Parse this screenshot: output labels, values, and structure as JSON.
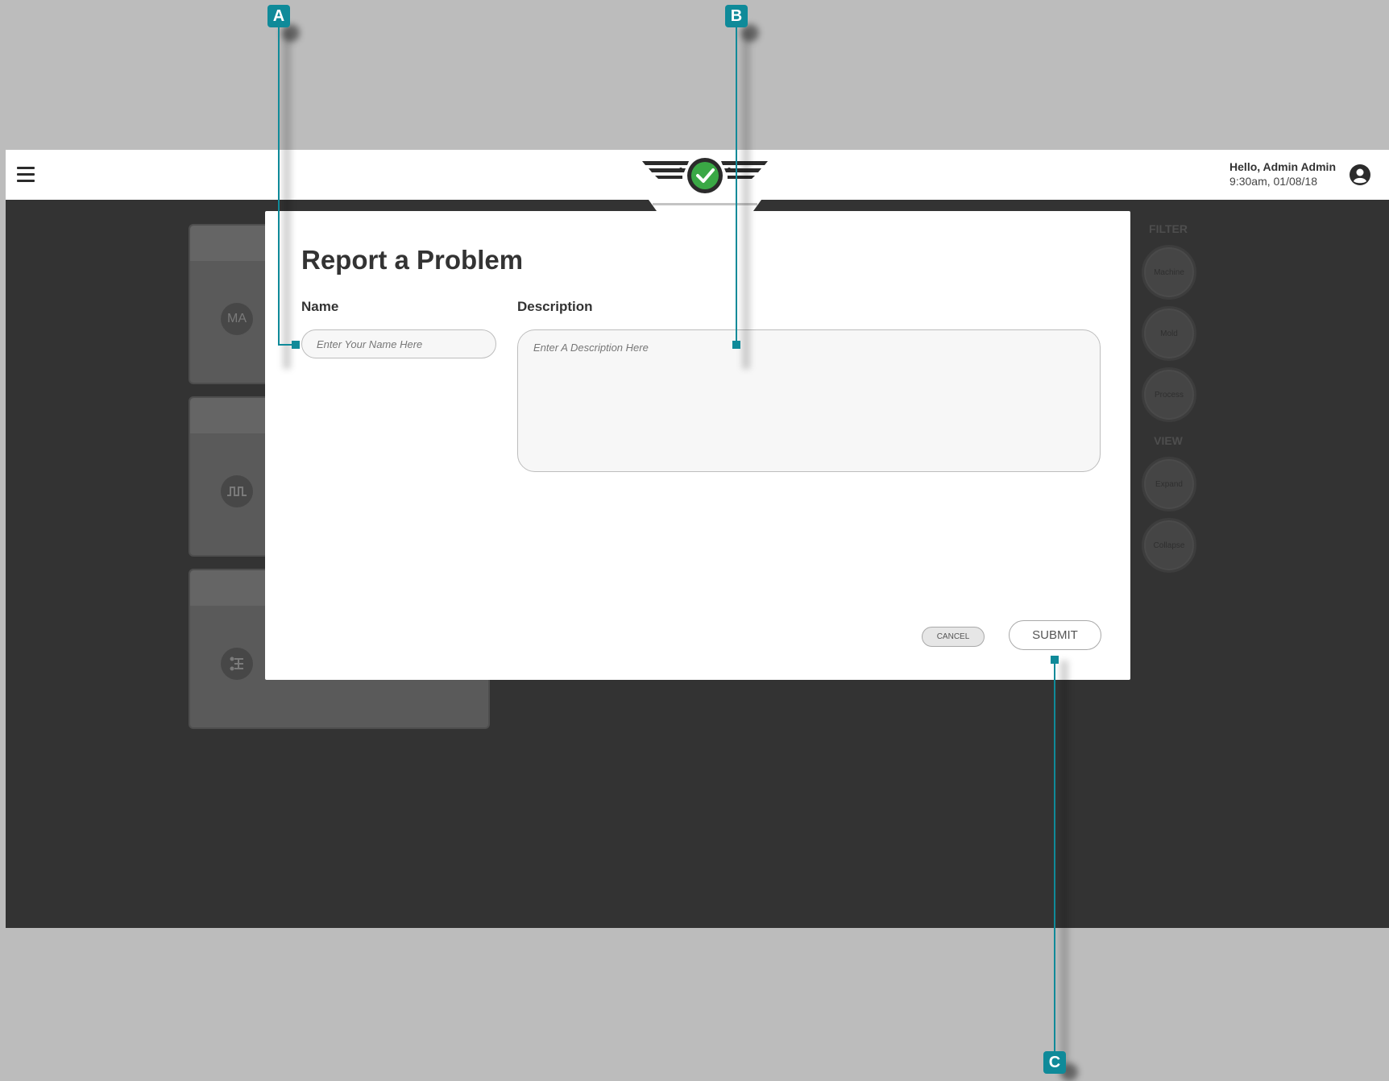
{
  "header": {
    "greeting": "Hello, Admin Admin",
    "datetime": "9:30am, 01/08/18",
    "logo_colors": {
      "check_bg": "#3aa845",
      "wings": "#2b2b2b"
    }
  },
  "background_cards": [
    {
      "badge": "MA"
    },
    {
      "badge_icon": "pulse-icon"
    },
    {
      "badge_icon": "process-icon"
    }
  ],
  "right_rail": {
    "filter_label": "FILTER",
    "filter_buttons": [
      "Machine",
      "Mold",
      "Process"
    ],
    "view_label": "VIEW",
    "view_buttons": [
      "Expand",
      "Collapse"
    ]
  },
  "modal": {
    "title": "Report a Problem",
    "name_label": "Name",
    "name_placeholder": "Enter Your Name Here",
    "description_label": "Description",
    "description_placeholder": "Enter A Description Here",
    "cancel_label": "CANCEL",
    "submit_label": "SUBMIT"
  },
  "callouts": [
    "A",
    "B",
    "C"
  ],
  "colors": {
    "accent": "#0f8a99",
    "app_bg": "#333333",
    "page_bg": "#bcbcbc"
  }
}
